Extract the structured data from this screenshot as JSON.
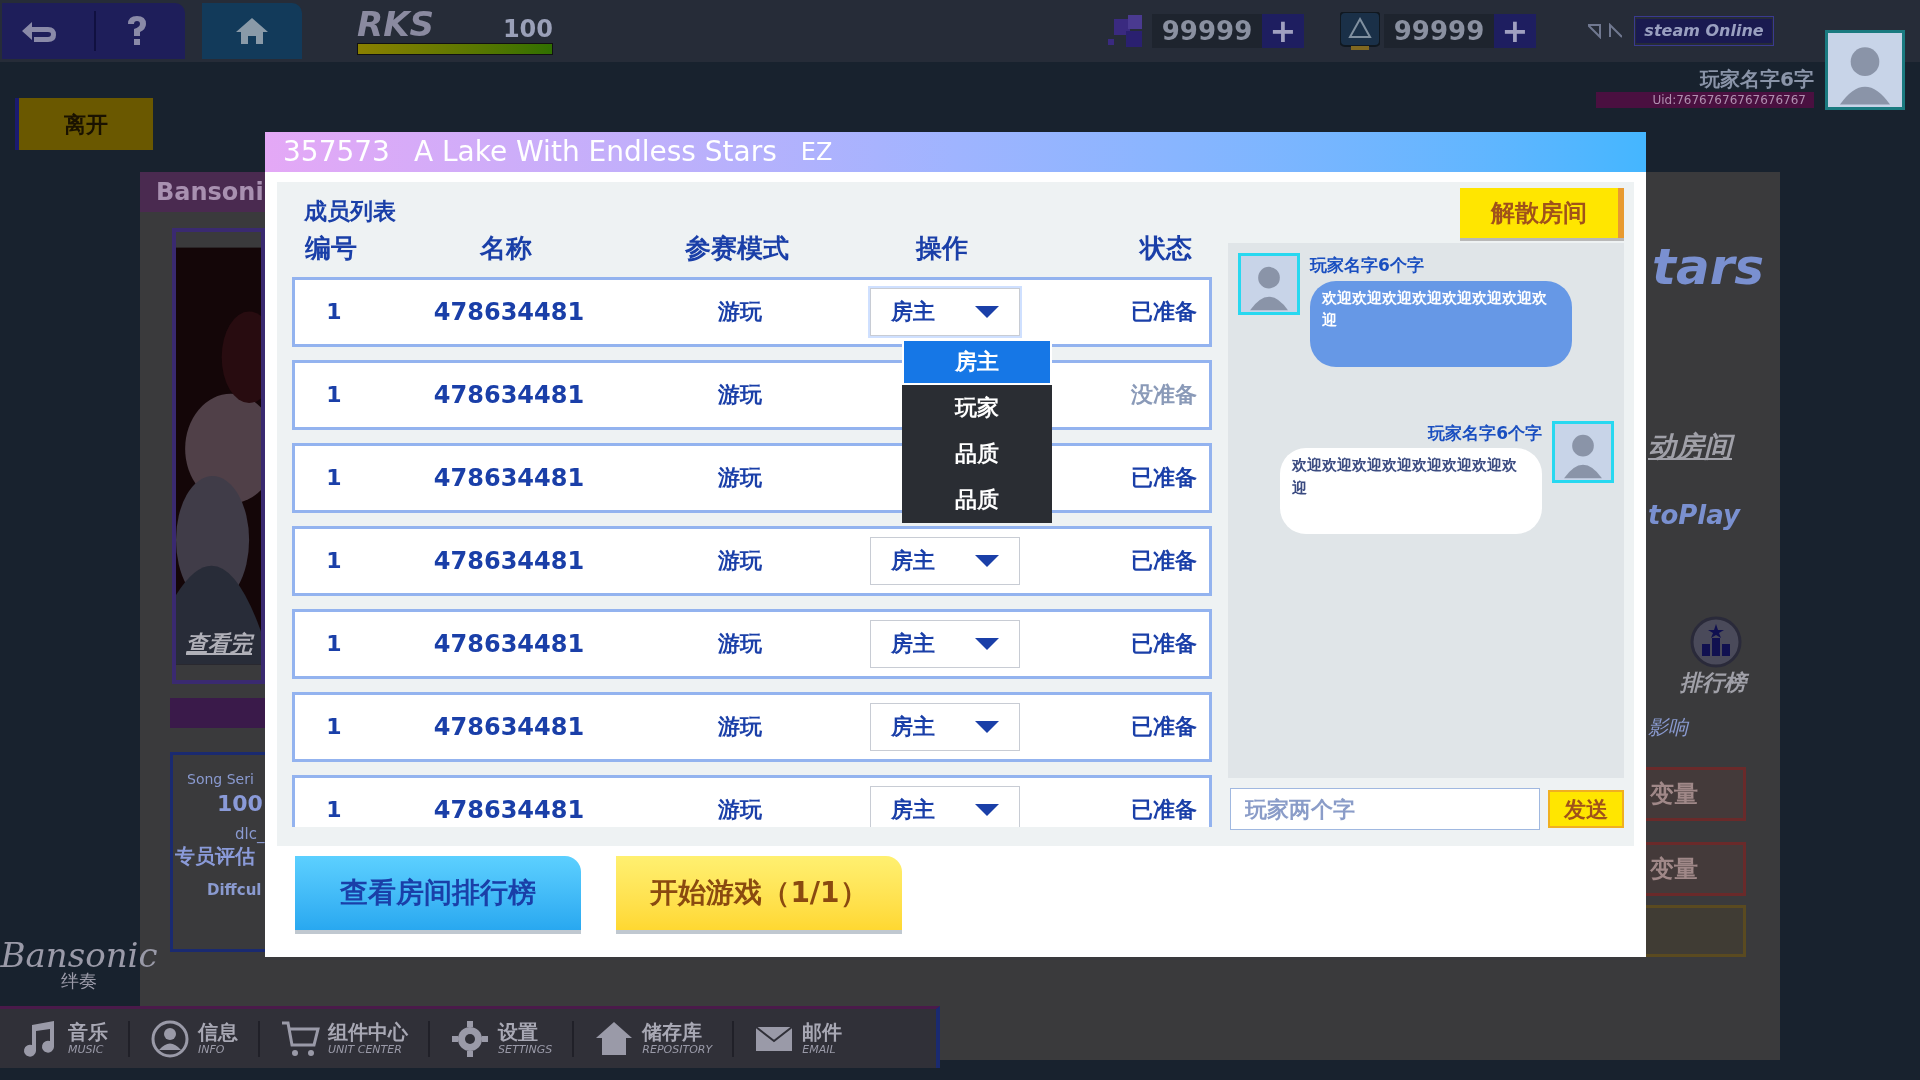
{
  "top_bar": {
    "rks_label": "RKS",
    "rks_value": "100",
    "rks": {
      "level": 1
    },
    "currencies": [
      {
        "amount": "99999",
        "add": "+"
      },
      {
        "amount": "99999",
        "add": "+"
      }
    ],
    "status": "steam Online",
    "player_name": "玩家名字6字",
    "uid": "Uid:76767676767676767"
  },
  "leave_button": "离开",
  "background": {
    "card_title": "Bansoni",
    "cover_link": "查看完",
    "song_series_label": "Song Seri",
    "song_series_value": "100",
    "dlc": "dlc_",
    "evaluation": "专员评估",
    "difficulty_label": "Diffcul",
    "song_title": "tars",
    "room_link": "动房间",
    "autoplay": "toPlay",
    "leaderboard": "排行榜",
    "effect": "影响",
    "variable_buttons": [
      "变量",
      "变量"
    ],
    "logo": "Bansonic",
    "logo_subtitle": "绊奏"
  },
  "room": {
    "id": "357573",
    "song": "A Lake With Endless Stars",
    "difficulty": "EZ",
    "disband_button": "解散房间",
    "member_list_title": "成员列表",
    "columns": [
      "编号",
      "名称",
      "参赛模式",
      "操作",
      "状态"
    ],
    "members": [
      {
        "number": "1",
        "name": "478634481",
        "mode": "游玩",
        "role": "房主",
        "expanded": true,
        "status": "已准备",
        "ready": true
      },
      {
        "number": "1",
        "name": "478634481",
        "mode": "游玩",
        "status": "没准备",
        "ready": false
      },
      {
        "number": "1",
        "name": "478634481",
        "mode": "游玩",
        "status": "已准备",
        "ready": true
      },
      {
        "number": "1",
        "name": "478634481",
        "mode": "游玩",
        "role": "房主",
        "expanded": false,
        "status": "已准备",
        "ready": true
      },
      {
        "number": "1",
        "name": "478634481",
        "mode": "游玩",
        "role": "房主",
        "expanded": false,
        "status": "已准备",
        "ready": true
      },
      {
        "number": "1",
        "name": "478634481",
        "mode": "游玩",
        "role": "房主",
        "expanded": false,
        "status": "已准备",
        "ready": true
      },
      {
        "number": "1",
        "name": "478634481",
        "mode": "游玩",
        "role": "房主",
        "expanded": false,
        "status": "已准备",
        "ready": true
      }
    ],
    "role_menu": [
      {
        "label": "房主",
        "selected": true
      },
      {
        "label": "玩家",
        "selected": false
      },
      {
        "label": "品质",
        "selected": false
      },
      {
        "label": "品质",
        "selected": false
      }
    ],
    "chat": {
      "messages": [
        {
          "sender": "玩家名字6个字",
          "text": "欢迎欢迎欢迎欢迎欢迎欢迎欢迎欢迎",
          "mine": false
        },
        {
          "sender": "玩家名字6个字",
          "text": "欢迎欢迎欢迎欢迎欢迎欢迎欢迎欢迎",
          "mine": true
        }
      ],
      "input_placeholder": "玩家两个字",
      "send_button": "发送"
    },
    "leaderboard_button": "查看房间排行榜",
    "start_button": "开始游戏（1/1）"
  },
  "bottom_nav": [
    {
      "label": "音乐",
      "sublabel": "MUSIC"
    },
    {
      "label": "信息",
      "sublabel": "INFO"
    },
    {
      "label": "组件中心",
      "sublabel": "UNIT CENTER"
    },
    {
      "label": "设置",
      "sublabel": "SETTINGS"
    },
    {
      "label": "储存库",
      "sublabel": "REPOSITORY"
    },
    {
      "label": "邮件",
      "sublabel": "EMAIL"
    }
  ]
}
